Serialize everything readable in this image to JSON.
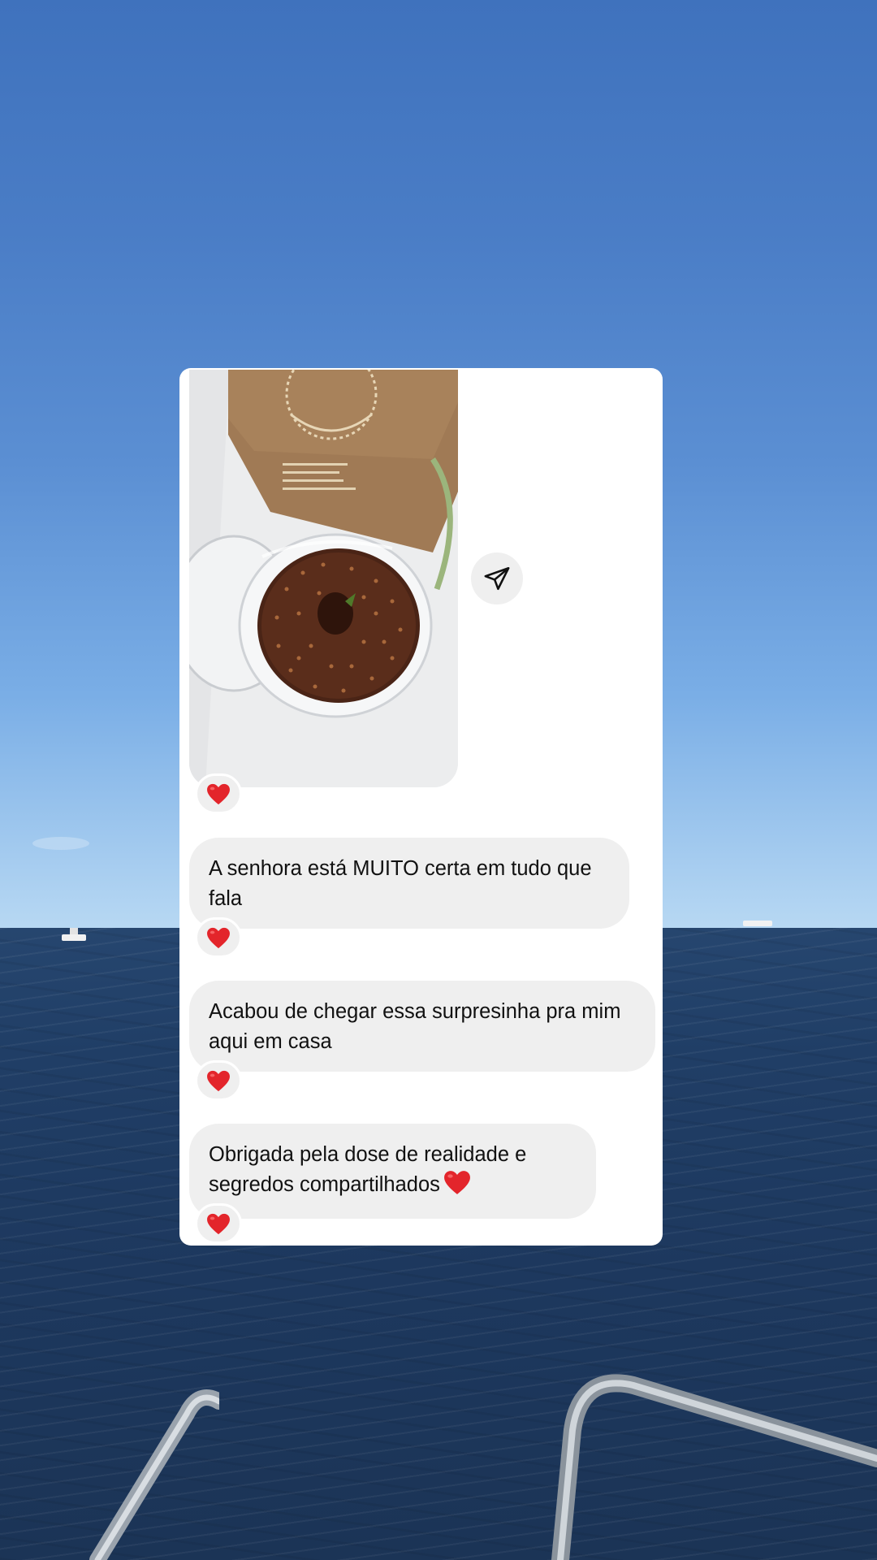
{
  "messages": [
    {
      "text": "A senhora está MUITO certa em tudo que fala",
      "reaction": "red-heart"
    },
    {
      "text": "Acabou de chegar essa surpresinha pra mim aqui em casa",
      "reaction": "red-heart"
    },
    {
      "text": "Obrigada pela dose de realidade e segredos compartilhados",
      "trailing_emoji": "red-heart",
      "reaction": "red-heart"
    }
  ],
  "shared_photo": {
    "reaction": "red-heart",
    "share_icon": "paper-plane-icon"
  },
  "colors": {
    "bubble": "#efefef",
    "card": "#ffffff",
    "heart": "#e3252b",
    "sky_top": "#3f72bd",
    "sea": "#1d385e"
  }
}
